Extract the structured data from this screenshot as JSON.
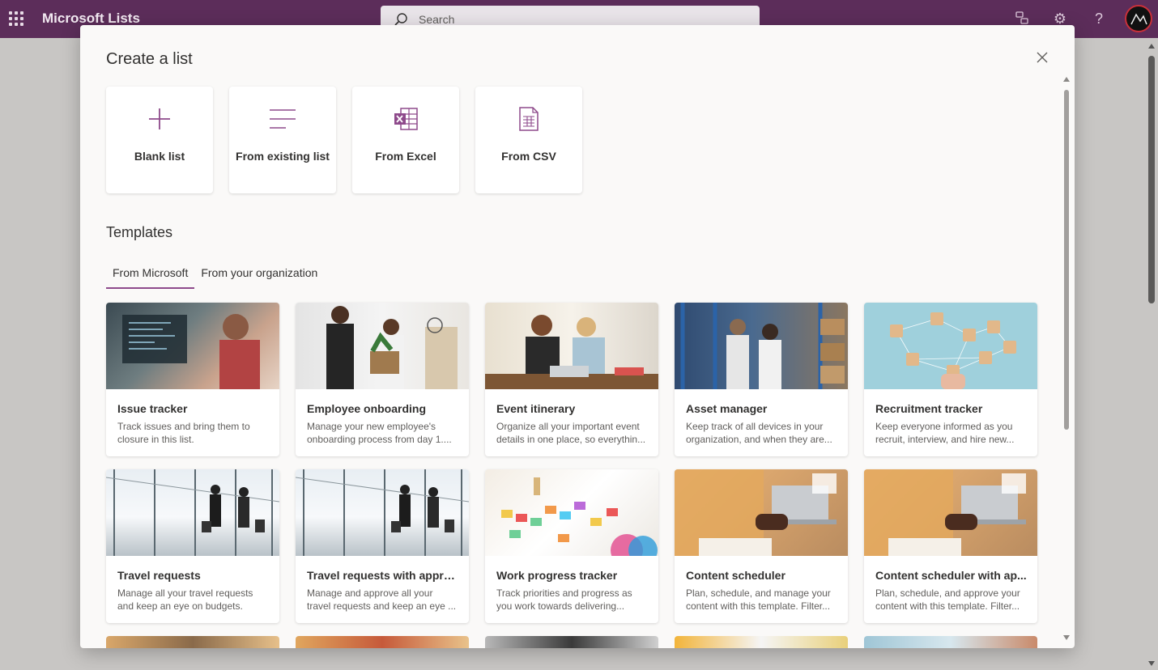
{
  "app": {
    "name": "Microsoft Lists",
    "search_placeholder": "Search",
    "accent": "#5c2d5a"
  },
  "dialog": {
    "title": "Create a list",
    "close_icon": "close-icon",
    "create_options": [
      {
        "label": "Blank list",
        "icon": "plus-icon"
      },
      {
        "label": "From existing list",
        "icon": "list-lines-icon"
      },
      {
        "label": "From Excel",
        "icon": "excel-icon"
      },
      {
        "label": "From CSV",
        "icon": "csv-file-icon"
      }
    ],
    "templates_title": "Templates",
    "tabs": [
      {
        "label": "From Microsoft",
        "active": true
      },
      {
        "label": "From your organization",
        "active": false
      }
    ],
    "templates": [
      {
        "title": "Issue tracker",
        "desc": "Track issues and bring them to closure in this list."
      },
      {
        "title": "Employee onboarding",
        "desc": "Manage your new employee's onboarding process from day 1...."
      },
      {
        "title": "Event itinerary",
        "desc": "Organize all your important event details in one place, so everythin..."
      },
      {
        "title": "Asset manager",
        "desc": "Keep track of all devices in your organization, and when they are..."
      },
      {
        "title": "Recruitment tracker",
        "desc": "Keep everyone informed as you recruit, interview, and hire new..."
      },
      {
        "title": "Travel requests",
        "desc": "Manage all your travel requests and keep an eye on budgets."
      },
      {
        "title": "Travel requests with approv...",
        "desc": "Manage and approve all your travel requests and keep an eye ..."
      },
      {
        "title": "Work progress tracker",
        "desc": "Track priorities and progress as you work towards delivering..."
      },
      {
        "title": "Content scheduler",
        "desc": "Plan, schedule, and manage your content with this template. Filter..."
      },
      {
        "title": "Content scheduler with ap...",
        "desc": "Plan, schedule, and approve your content with this template. Filter..."
      }
    ]
  }
}
